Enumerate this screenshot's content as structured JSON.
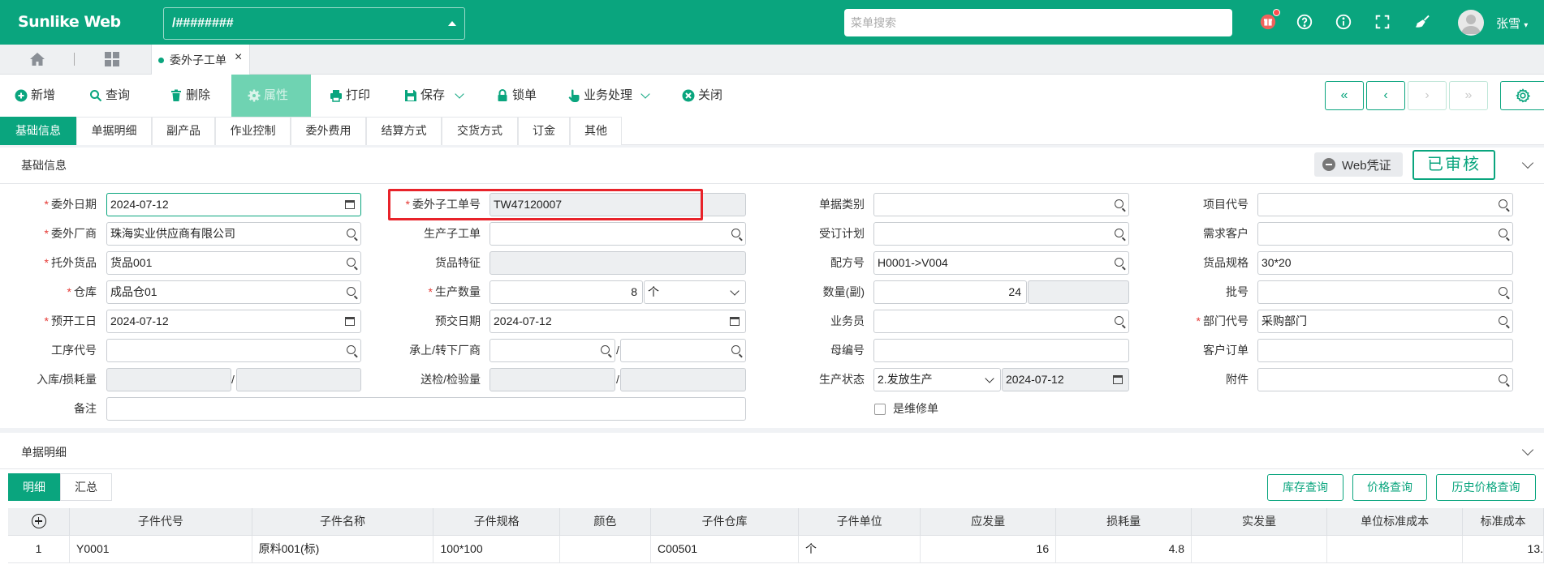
{
  "header": {
    "brand": "Sunlike Web",
    "db_value": "/########",
    "menu_search_placeholder": "菜单搜索",
    "username": "张雪",
    "accent": "#0aa57e"
  },
  "tabs": {
    "active_label": "委外子工单",
    "close": "×"
  },
  "toolbar": {
    "items": [
      {
        "label": "新增",
        "icon": "plus-circle-icon"
      },
      {
        "label": "查询",
        "icon": "search-icon"
      },
      {
        "label": "删除",
        "icon": "trash-icon"
      },
      {
        "label": "属性",
        "icon": "gear-icon"
      },
      {
        "label": "打印",
        "icon": "printer-icon"
      },
      {
        "label": "保存",
        "icon": "save-icon"
      },
      {
        "label": "锁单",
        "icon": "lock-icon"
      },
      {
        "label": "业务处理",
        "icon": "hand-pointer-icon"
      },
      {
        "label": "关闭",
        "icon": "close-circle-icon"
      }
    ],
    "nav": [
      "«",
      "‹",
      "›",
      "»"
    ]
  },
  "subtabs": [
    "基础信息",
    "单据明细",
    "副产品",
    "作业控制",
    "委外费用",
    "结算方式",
    "交货方式",
    "订金",
    "其他"
  ],
  "basic_section": {
    "title": "基础信息",
    "web_cert": "Web凭证",
    "status": "已审核"
  },
  "form": {
    "col1": [
      {
        "label": "委外日期",
        "value": "2024-07-12"
      },
      {
        "label": "委外厂商",
        "value": "珠海实业供应商有限公司"
      },
      {
        "label": "托外货品",
        "value": "货品001"
      },
      {
        "label": "仓库",
        "value": "成品仓01"
      },
      {
        "label": "预开工日",
        "value": "2024-07-12"
      },
      {
        "label": "工序代号",
        "value": ""
      },
      {
        "label": "入库/损耗量",
        "value": ""
      },
      {
        "label": "备注",
        "value": ""
      }
    ],
    "col2": [
      {
        "label": "委外子工单号",
        "value": "TW47120007"
      },
      {
        "label": "生产子工单",
        "value": ""
      },
      {
        "label": "货品特征",
        "value": ""
      },
      {
        "label": "生产数量",
        "value": "8",
        "unit": "个"
      },
      {
        "label": "预交日期",
        "value": "2024-07-12"
      },
      {
        "label": "承上/转下厂商",
        "value": ""
      },
      {
        "label": "送检/检验量",
        "value": ""
      }
    ],
    "col3": [
      {
        "label": "单据类别",
        "value": ""
      },
      {
        "label": "受订计划",
        "value": ""
      },
      {
        "label": "配方号",
        "value": "H0001->V004"
      },
      {
        "label": "数量(副)",
        "value": "24"
      },
      {
        "label": "业务员",
        "value": ""
      },
      {
        "label": "母编号",
        "value": ""
      },
      {
        "label": "生产状态",
        "value": "2.发放生产",
        "date": "2024-07-12"
      },
      {
        "label": "是维修单",
        "value": ""
      }
    ],
    "col4": [
      {
        "label": "项目代号",
        "value": ""
      },
      {
        "label": "需求客户",
        "value": ""
      },
      {
        "label": "货品规格",
        "value": "30*20"
      },
      {
        "label": "批号",
        "value": ""
      },
      {
        "label": "部门代号",
        "value": "采购部门"
      },
      {
        "label": "客户订单",
        "value": ""
      },
      {
        "label": "附件",
        "value": ""
      }
    ]
  },
  "detail_section": {
    "title": "单据明细",
    "toggles": [
      "明细",
      "汇总"
    ],
    "buttons": [
      "库存查询",
      "价格查询",
      "历史价格查询"
    ],
    "columns": [
      "子件代号",
      "子件名称",
      "子件规格",
      "颜色",
      "子件仓库",
      "子件单位",
      "应发量",
      "损耗量",
      "实发量",
      "单位标准成本",
      "标准成本"
    ],
    "rows": [
      [
        "1",
        "Y0001",
        "原料001(标)",
        "100*100",
        "",
        "C00501",
        "个",
        "16",
        "4.8",
        "",
        "",
        "13."
      ]
    ]
  }
}
